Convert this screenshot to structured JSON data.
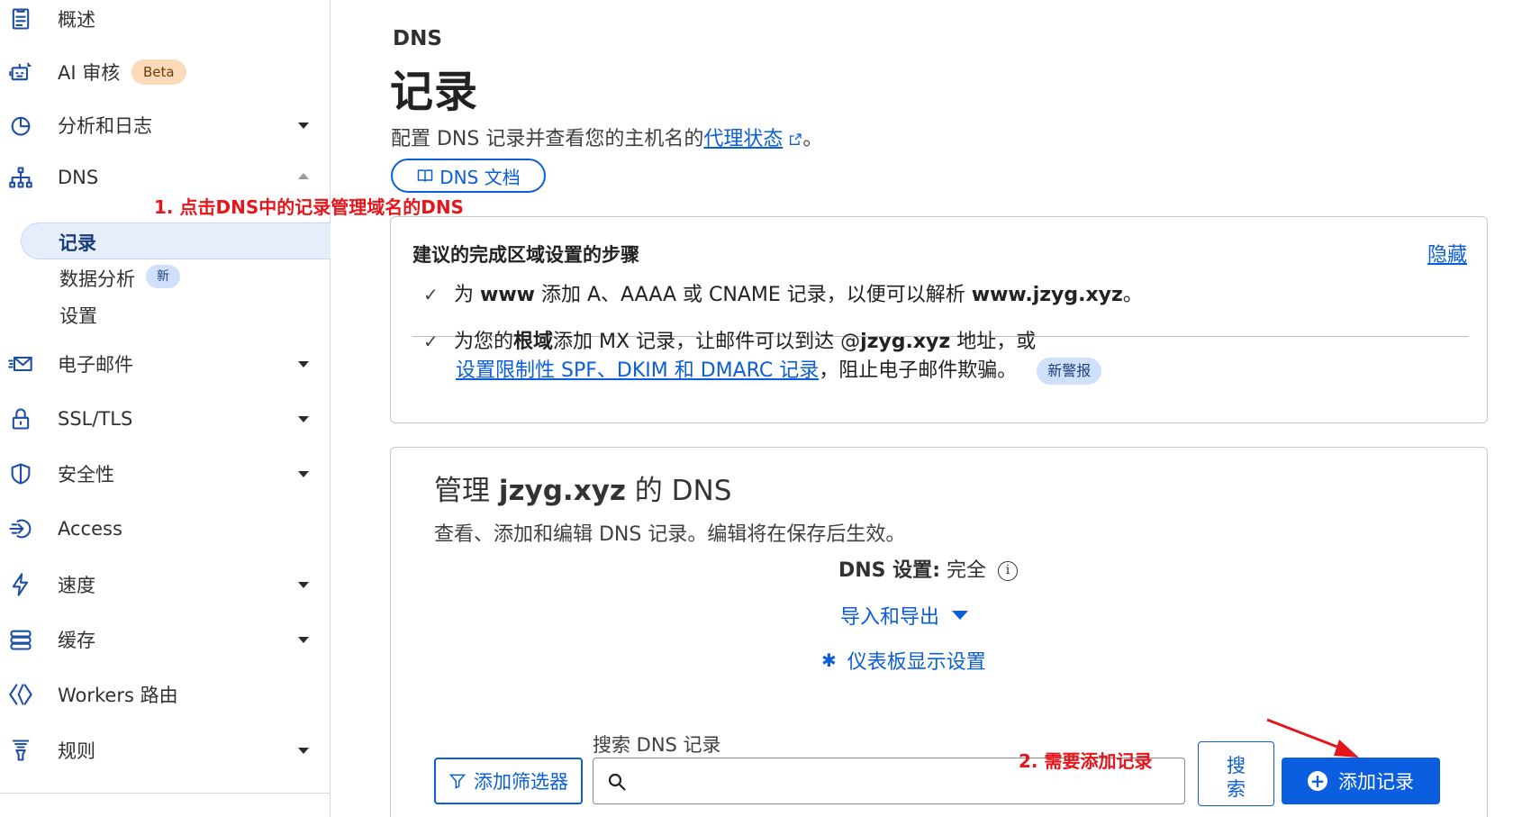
{
  "sidebar": {
    "items": [
      {
        "label": "概述",
        "icon": "clipboard-icon"
      },
      {
        "label": "AI 审核",
        "icon": "ai-bot-icon",
        "badge": "Beta"
      },
      {
        "label": "分析和日志",
        "icon": "chart-pie-icon"
      },
      {
        "label": "DNS",
        "icon": "dns-network-icon"
      },
      {
        "label": "电子邮件",
        "icon": "email-icon"
      },
      {
        "label": "SSL/TLS",
        "icon": "lock-icon"
      },
      {
        "label": "安全性",
        "icon": "shield-icon"
      },
      {
        "label": "Access",
        "icon": "access-icon"
      },
      {
        "label": "速度",
        "icon": "lightning-icon"
      },
      {
        "label": "缓存",
        "icon": "cache-icon"
      },
      {
        "label": "Workers 路由",
        "icon": "workers-icon"
      },
      {
        "label": "规则",
        "icon": "rules-icon"
      }
    ],
    "dns_subitems": [
      {
        "label": "记录",
        "active": true
      },
      {
        "label": "数据分析",
        "badge": "新"
      },
      {
        "label": "设置"
      }
    ]
  },
  "header": {
    "eyebrow": "DNS",
    "title": "记录",
    "intro_text": "配置 DNS 记录并查看您的主机名的",
    "intro_link": "代理状态",
    "intro_end": "。",
    "docs_button": "DNS 文档"
  },
  "annotations": {
    "step1": "1. 点击DNS中的记录管理域名的DNS",
    "step2": "2. 需要添加记录"
  },
  "steps_card": {
    "title": "建议的完成区域设置的步骤",
    "hide_label": "隐藏",
    "step1": {
      "pre": "为 ",
      "bold1": "www",
      "mid": " 添加 A、AAAA 或 CNAME 记录，以便可以解析 ",
      "bold2": "www.jzyg.xyz",
      "post": "。"
    },
    "step2": {
      "pre": "为您的",
      "bold1": "根域",
      "mid": "添加 MX 记录，让邮件可以到达 @",
      "bold2": "jzyg.xyz",
      "post": " 地址，或",
      "link": "设置限制性 SPF、DKIM 和 DMARC 记录",
      "tail": "，阻止电子邮件欺骗。",
      "badge": "新警报"
    }
  },
  "manage_card": {
    "title_pre": "管理 ",
    "title_domain": "jzyg.xyz",
    "title_post": " 的 DNS",
    "description": "查看、添加和编辑 DNS 记录。编辑将在保存后生效。",
    "dns_setting_label": "DNS 设置",
    "dns_setting_colon": ":",
    "dns_setting_value": "完全",
    "import_export": "导入和导出",
    "dashboard_settings": "仪表板显示设置",
    "search_label": "搜索 DNS 记录",
    "search_value": "",
    "filter_button": "添加筛选器",
    "search_button_line1": "搜",
    "search_button_line2": "索",
    "add_button": "添加记录"
  },
  "colors": {
    "accent": "#0b5ed7",
    "annotation": "#e5161b",
    "icon": "#1f4ea6"
  }
}
